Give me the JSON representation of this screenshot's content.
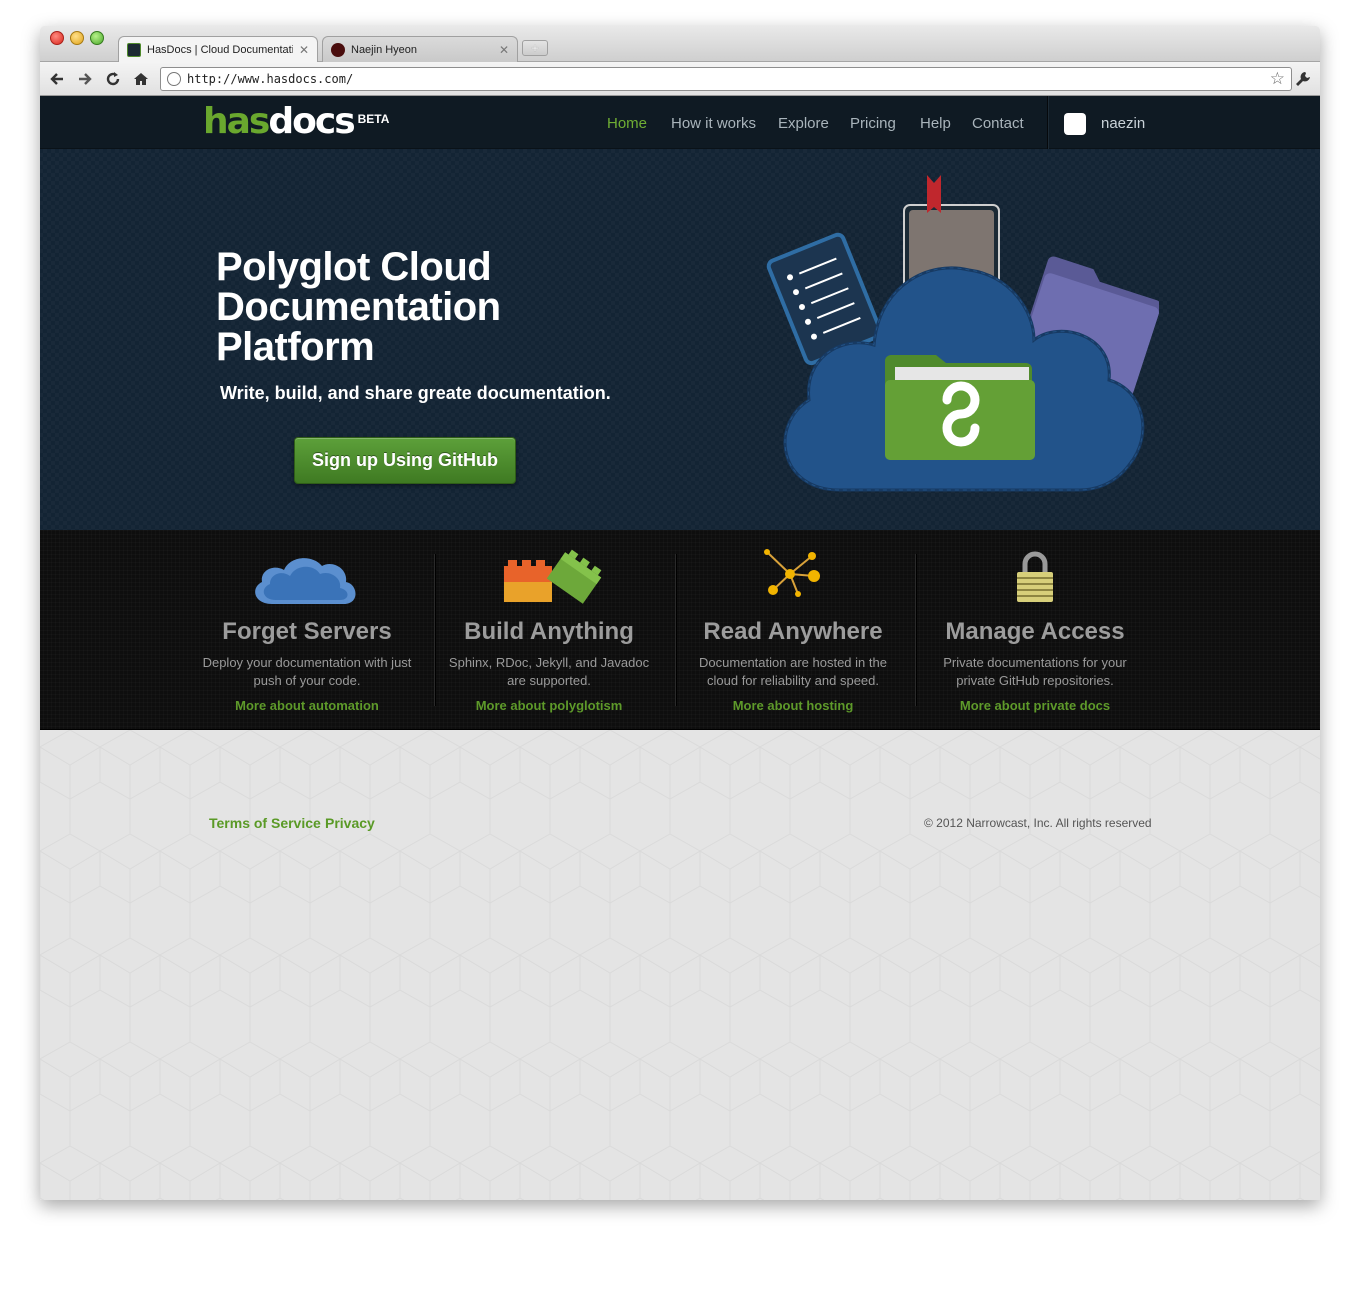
{
  "browser": {
    "tabs": [
      {
        "title": "HasDocs | Cloud Documentatic",
        "active": true
      },
      {
        "title": "Naejin Hyeon",
        "active": false
      }
    ],
    "new_tab_label": "+",
    "close_glyph": "✕",
    "url": "http://www.hasdocs.com/",
    "icons": {
      "back": "back-arrow-icon",
      "forward": "forward-arrow-icon",
      "reload": "reload-icon",
      "home": "home-icon",
      "star": "bookmark-star-icon",
      "wrench": "wrench-icon"
    }
  },
  "header": {
    "logo_has": "has",
    "logo_docs": "docs",
    "logo_beta": "BETA",
    "nav": [
      {
        "label": "Home",
        "current": true
      },
      {
        "label": "How it works",
        "current": false
      },
      {
        "label": "Explore",
        "current": false
      },
      {
        "label": "Pricing",
        "current": false
      },
      {
        "label": "Help",
        "current": false
      },
      {
        "label": "Contact",
        "current": false
      }
    ],
    "username": "naezin"
  },
  "hero": {
    "title": "Polyglot Cloud Documentation Platform",
    "subtitle": "Write, build, and share greate documentation.",
    "cta": "Sign up Using GitHub"
  },
  "features": [
    {
      "icon": "cloud-icon",
      "title": "Forget Servers",
      "text": "Deploy your documentation with just push of your code.",
      "link": "More about automation"
    },
    {
      "icon": "blocks-icon",
      "title": "Build Anything",
      "text": "Sphinx, RDoc, Jekyll, and Javadoc are supported.",
      "link": "More about polyglotism"
    },
    {
      "icon": "network-icon",
      "title": "Read Anywhere",
      "text": "Documentation are hosted in the cloud for reliability and speed.",
      "link": "More about hosting"
    },
    {
      "icon": "padlock-icon",
      "title": "Manage Access",
      "text": "Private documentations for your private GitHub repositories.",
      "link": "More about private docs"
    }
  ],
  "footer": {
    "links": [
      "Terms of Service",
      "Privacy"
    ],
    "copyright": "© 2012 Narrowcast, Inc. All rights reserved"
  },
  "colors": {
    "brand_green": "#6aa82e",
    "header_bg": "#0f1a23",
    "hero_bg": "#132434",
    "features_bg": "#0e0e0e",
    "footer_bg": "#e4e4e4"
  }
}
